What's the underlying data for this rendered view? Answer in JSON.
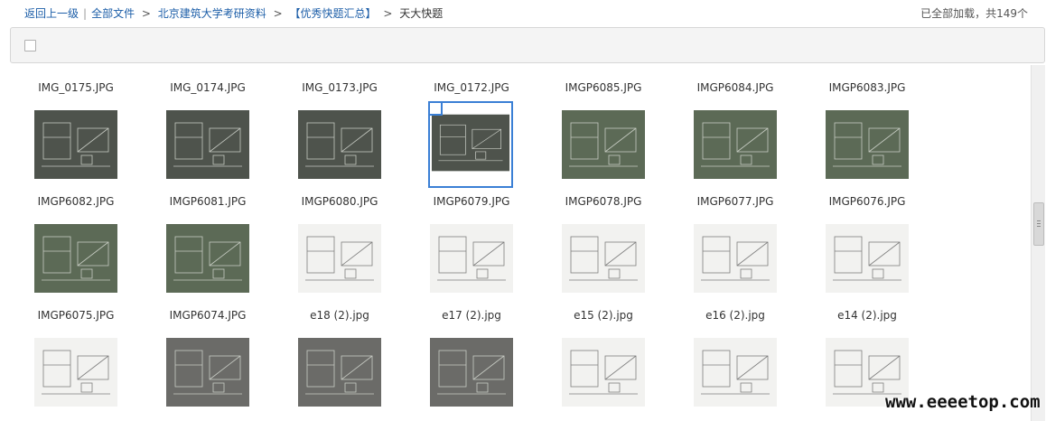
{
  "breadcrumb": {
    "back": "返回上一级",
    "all_files": "全部文件",
    "level1": "北京建筑大学考研资料",
    "level2": "【优秀快题汇总】",
    "current": "天大快题",
    "pipe": "|",
    "separator": ">"
  },
  "status": {
    "loaded_text": "已全部加载，共149个"
  },
  "files": [
    {
      "name": "IMG_0175.JPG",
      "style": "dark"
    },
    {
      "name": "IMG_0174.JPG",
      "style": "dark"
    },
    {
      "name": "IMG_0173.JPG",
      "style": "dark"
    },
    {
      "name": "IMG_0172.JPG",
      "style": "dark",
      "selected": true
    },
    {
      "name": "IMGP6085.JPG",
      "style": "green"
    },
    {
      "name": "IMGP6084.JPG",
      "style": "green"
    },
    {
      "name": "IMGP6083.JPG",
      "style": "green"
    },
    {
      "name": "IMGP6082.JPG",
      "style": "green"
    },
    {
      "name": "IMGP6081.JPG",
      "style": "green"
    },
    {
      "name": "IMGP6080.JPG",
      "style": "light"
    },
    {
      "name": "IMGP6079.JPG",
      "style": "light"
    },
    {
      "name": "IMGP6078.JPG",
      "style": "light"
    },
    {
      "name": "IMGP6077.JPG",
      "style": "light"
    },
    {
      "name": "IMGP6076.JPG",
      "style": "light"
    },
    {
      "name": "IMGP6075.JPG",
      "style": "light"
    },
    {
      "name": "IMGP6074.JPG",
      "style": "gray"
    },
    {
      "name": "e18 (2).jpg",
      "style": "gray"
    },
    {
      "name": "e17 (2).jpg",
      "style": "gray"
    },
    {
      "name": "e15 (2).jpg",
      "style": "light"
    },
    {
      "name": "e16 (2).jpg",
      "style": "light"
    },
    {
      "name": "e14 (2).jpg",
      "style": "light"
    }
  ],
  "palette": {
    "dark": "#4e534c",
    "green": "#5c6a56",
    "light": "#f2f2f0",
    "gray": "#6b6b68",
    "link": "#1c5ea8",
    "selected": "#3a7fd5"
  },
  "watermark": "www.eeeetop.com"
}
